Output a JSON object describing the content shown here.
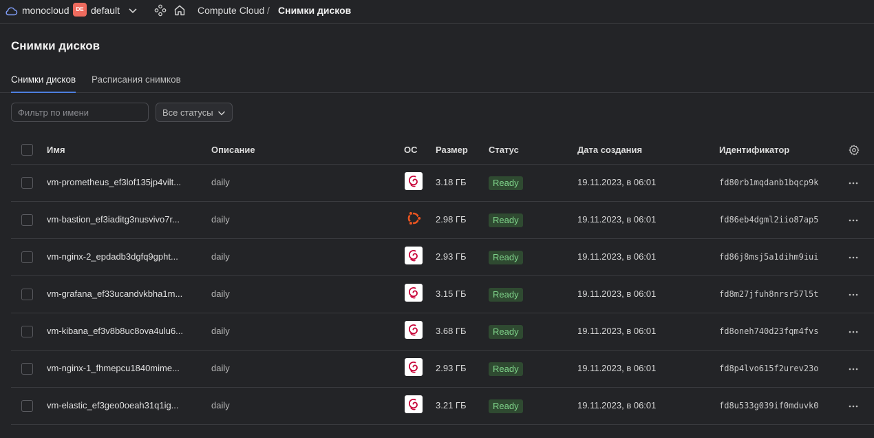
{
  "topbar": {
    "cloud_name": "monocloud",
    "badge": "DE",
    "folder_name": "default",
    "breadcrumb_service": "Compute Cloud",
    "breadcrumb_sep": "/",
    "breadcrumb_current": "Снимки дисков"
  },
  "page": {
    "title": "Снимки дисков"
  },
  "tabs": [
    {
      "label": "Снимки дисков",
      "active": true
    },
    {
      "label": "Расписания снимков",
      "active": false
    }
  ],
  "filter": {
    "placeholder": "Фильтр по имени",
    "value": ""
  },
  "status_filter": {
    "label": "Все статусы"
  },
  "table": {
    "headers": {
      "name": "Имя",
      "description": "Описание",
      "os": "ОС",
      "size": "Размер",
      "status": "Статус",
      "created": "Дата создания",
      "id": "Идентификатор"
    },
    "rows": [
      {
        "name": "vm-prometheus_ef3lof135jp4vilt...",
        "description": "daily",
        "os_icon": "debian-icon",
        "size": "3.18 ГБ",
        "status": "Ready",
        "created": "19.11.2023, в 06:01",
        "id": "fd80rb1mqdanb1bqcp9k"
      },
      {
        "name": "vm-bastion_ef3iaditg3nusvivo7r...",
        "description": "daily",
        "os_icon": "ubuntu-icon",
        "size": "2.98 ГБ",
        "status": "Ready",
        "created": "19.11.2023, в 06:01",
        "id": "fd86eb4dgml2iio87ap5"
      },
      {
        "name": "vm-nginx-2_epdadb3dgfq9gpht...",
        "description": "daily",
        "os_icon": "debian-icon",
        "size": "2.93 ГБ",
        "status": "Ready",
        "created": "19.11.2023, в 06:01",
        "id": "fd86j8msj5a1dihm9iui"
      },
      {
        "name": "vm-grafana_ef33ucandvkbha1m...",
        "description": "daily",
        "os_icon": "debian-icon",
        "size": "3.15 ГБ",
        "status": "Ready",
        "created": "19.11.2023, в 06:01",
        "id": "fd8m27jfuh8nrsr57l5t"
      },
      {
        "name": "vm-kibana_ef3v8b8uc8ova4ulu6...",
        "description": "daily",
        "os_icon": "debian-icon",
        "size": "3.68 ГБ",
        "status": "Ready",
        "created": "19.11.2023, в 06:01",
        "id": "fd8oneh740d23fqm4fvs"
      },
      {
        "name": "vm-nginx-1_fhmepcu1840mime...",
        "description": "daily",
        "os_icon": "debian-icon",
        "size": "2.93 ГБ",
        "status": "Ready",
        "created": "19.11.2023, в 06:01",
        "id": "fd8p4lvo615f2urev23o"
      },
      {
        "name": "vm-elastic_ef3geo0oeah31q1ig...",
        "description": "daily",
        "os_icon": "debian-icon",
        "size": "3.21 ГБ",
        "status": "Ready",
        "created": "19.11.2023, в 06:01",
        "id": "fd8u533g039if0mduvk0"
      }
    ]
  },
  "colors": {
    "background": "#232427",
    "accent": "#4d7fe0",
    "badge": "#ef6b5e",
    "status_ready_bg": "#2f4a31",
    "status_ready_text": "#7fd38a",
    "debian": "#c70036",
    "ubuntu": "#e95420"
  }
}
